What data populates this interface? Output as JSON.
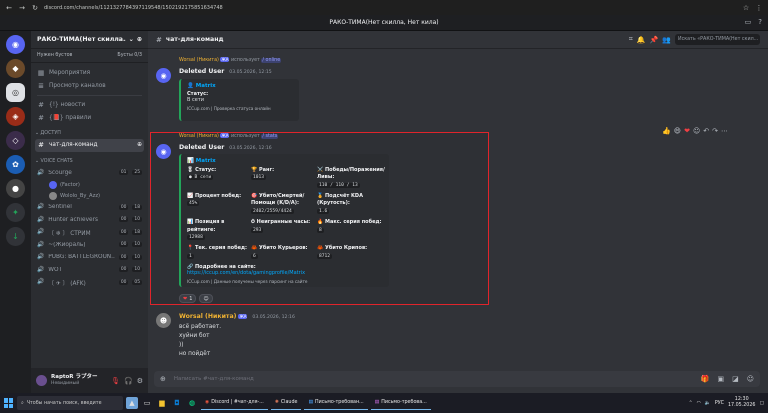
{
  "browser": {
    "url": "discord.com/channels/1121327784397119548/1502192175851634748",
    "back_icon": "arrow-left-icon",
    "forward_icon": "arrow-right-icon",
    "reload_icon": "reload-icon"
  },
  "app": {
    "title": "РАКО-ТИМА(Нет скилла, Нет кила)"
  },
  "server": {
    "name": "РАКО-ТИМА(Нет скилла...",
    "boost_label": "Нужен бустов",
    "boost_count": "Бусты 0/3",
    "channels_top": [
      {
        "icon": "events-icon",
        "name": "Мероприятия"
      },
      {
        "icon": "browse-icon",
        "name": "Просмотр каналов"
      }
    ],
    "text_channels": [
      {
        "icon": "#",
        "name": "{!} новости"
      },
      {
        "icon": "#",
        "name": "{📕} правили"
      }
    ],
    "category_access": "Доступ",
    "active_channel": "чат-для-команд",
    "category_voice": "Voice Chats",
    "voice": [
      {
        "name": "Scourge",
        "c1": "01",
        "c2": "25",
        "users": [
          "(Factor)",
          "Wololo_By_Azz)"
        ]
      },
      {
        "name": "Sentinel",
        "c1": "00",
        "c2": "18"
      },
      {
        "name": "Hunter achievers",
        "c1": "00",
        "c2": "10"
      },
      {
        "name": "〔 ❄ 〕 СТРИМ",
        "c1": "00",
        "c2": "18"
      },
      {
        "name": "~(Жиораль)",
        "c1": "00",
        "c2": "10"
      },
      {
        "name": "PUBG: BATTLEGROUN...",
        "c1": "00",
        "c2": "10"
      },
      {
        "name": "WOT",
        "c1": "00",
        "c2": "10"
      },
      {
        "name": "〔 ✈ 〕 (AFK)",
        "c1": "00",
        "c2": "05"
      }
    ]
  },
  "user": {
    "name": "RaptoR ラプター",
    "status": "Невидимый"
  },
  "channel": {
    "name": "чат-для-команд",
    "search_placeholder": "Искать «РАКО-ТИМА(Нет скил..."
  },
  "messages": {
    "m1": {
      "reply_user": "Worsal (Никита)",
      "reply_tag": "ЖА",
      "reply_text": "использует",
      "reply_cmd": "/ online",
      "author": "Deleted User",
      "time": "03.05.2026, 12:15",
      "embed_title": "Matrix",
      "k1": "Статус:",
      "v1": "В сети",
      "footer": "ICCup.com | Проверка статуса онлайн"
    },
    "m2": {
      "reply_user": "Worsal (Никита)",
      "reply_tag": "ЖА",
      "reply_text": "использует",
      "reply_cmd": "/ stats",
      "author": "Deleted User",
      "time": "03.05.2026, 12:16",
      "embed_title": "Matrix",
      "fields": [
        {
          "k": "🎖 Статус:",
          "v": "● В сети"
        },
        {
          "k": "🏆 Ранг:",
          "v": "1013"
        },
        {
          "k": "⚔️ Победы/Поражения/Ливы:",
          "v": "110 / 110 / 13"
        },
        {
          "k": "📈 Процент побед:",
          "v": "45%"
        },
        {
          "k": "🎯 Убито/Смертей/Помощи (K/D/A):",
          "v": "2402/2559/4424"
        },
        {
          "k": "🏅 Подсчёт KDA (Крутость):",
          "v": "1.6"
        },
        {
          "k": "📊 Позиция в рейтинге:",
          "v": "12988"
        },
        {
          "k": "⏱ Неигранные часы:",
          "v": "293"
        },
        {
          "k": "🔥 Макс. серия побед:",
          "v": "8"
        },
        {
          "k": "📍 Тек. серия побед:",
          "v": "1"
        },
        {
          "k": "🦀 Убито Курьеров:",
          "v": "6"
        },
        {
          "k": "🦀 Убито Крипов:",
          "v": "8712"
        }
      ],
      "link_label": "🔗 Подробнее на сайте:",
      "link": "https://iccup.com/en/dota/gamingprofile/Matrix",
      "footer": "ICCup.com | Данные получены через парсинг на сайте",
      "reaction_count": "1"
    },
    "m3": {
      "author": "Worsal (Никита)",
      "tag": "ЖА",
      "time": "03.05.2026, 12:16",
      "lines": [
        "всё работает.",
        "хуйни бот",
        "))",
        "но пойдёт"
      ]
    }
  },
  "composer": {
    "placeholder": "Написать #чат-для-команд"
  },
  "taskbar": {
    "search": "Чтобы начать поиск, введите",
    "apps": [
      "Discord | #чат-для-...",
      "Claude",
      "Письмо-требован...",
      "Письмо-требова..."
    ],
    "lang": "РУС",
    "time": "12:30",
    "date": "17.05.2026"
  },
  "colors": {
    "accent": "#5865f2",
    "highlight_border": "#e0242b",
    "online": "#23a55a"
  }
}
